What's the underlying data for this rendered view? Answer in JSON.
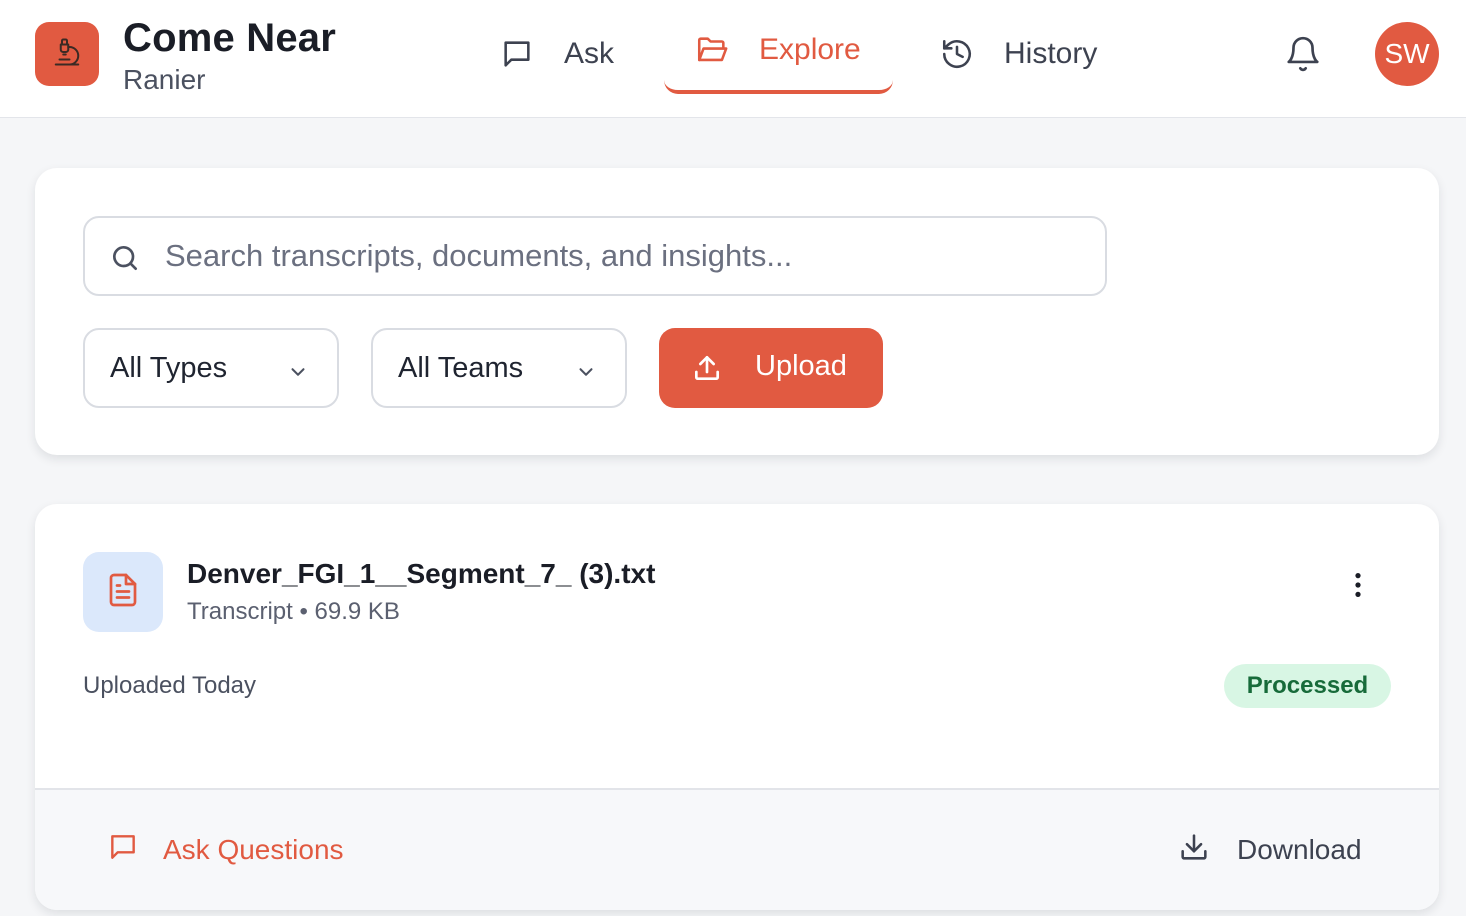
{
  "app": {
    "title": "Come Near",
    "subtitle": "Ranier",
    "logo_icon": "microscope-icon",
    "accent_color": "#e15a41"
  },
  "nav": {
    "items": [
      {
        "label": "Ask",
        "icon": "chat-bubble-icon",
        "active": false
      },
      {
        "label": "Explore",
        "icon": "folder-open-icon",
        "active": true
      },
      {
        "label": "History",
        "icon": "history-icon",
        "active": false
      }
    ],
    "notifications_icon": "bell-icon",
    "avatar_initials": "SW"
  },
  "search": {
    "placeholder": "Search transcripts, documents, and insights...",
    "value": "",
    "type_filter": "All Types",
    "team_filter": "All Teams",
    "upload_label": "Upload"
  },
  "files": [
    {
      "name": "Denver_FGI_1__Segment_7_ (3).txt",
      "type": "Transcript",
      "size": "69.9 KB",
      "meta": "Transcript • 69.9 KB",
      "uploaded": "Uploaded Today",
      "status": "Processed",
      "status_color": "#176b3a",
      "ask_label": "Ask Questions",
      "download_label": "Download"
    }
  ]
}
